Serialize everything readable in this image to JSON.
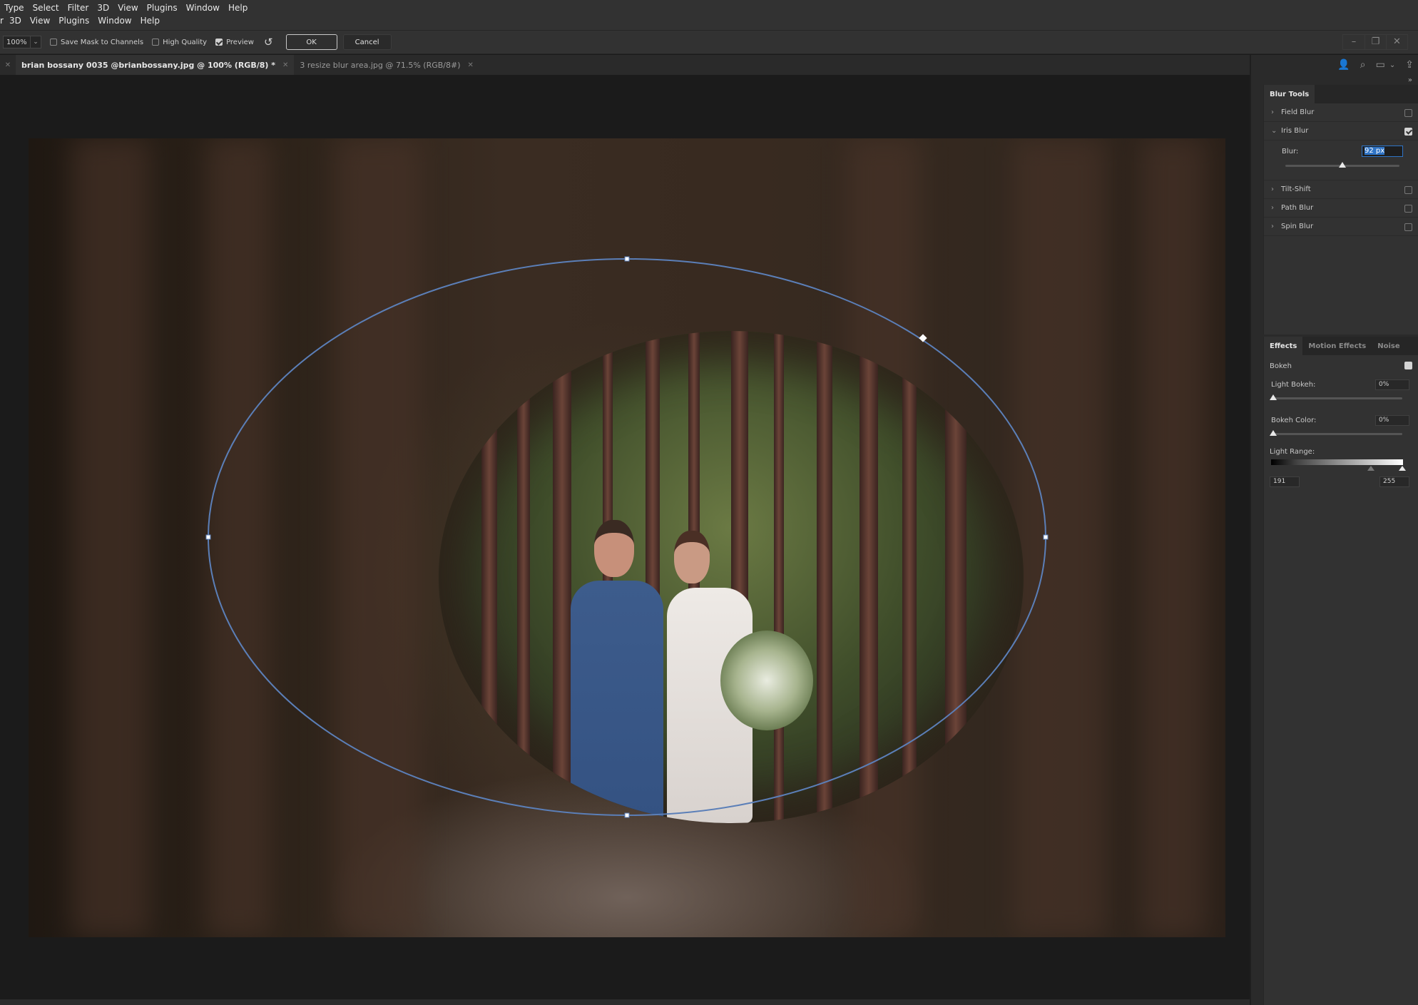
{
  "menubar_row1": [
    "Type",
    "Select",
    "Filter",
    "3D",
    "View",
    "Plugins",
    "Window",
    "Help"
  ],
  "menubar_row2": [
    "r",
    "3D",
    "View",
    "Plugins",
    "Window",
    "Help"
  ],
  "options": {
    "zoom_value": "100%",
    "save_mask_label": "Save Mask to Channels",
    "save_mask_checked": false,
    "high_quality_label": "High Quality",
    "high_quality_checked": false,
    "preview_label": "Preview",
    "preview_checked": true,
    "ok_label": "OK",
    "cancel_label": "Cancel"
  },
  "window_controls": {
    "minimize": "–",
    "restore": "❐",
    "close": "✕"
  },
  "tabs": [
    {
      "label": "brian bossany 0035 @brianbossany.jpg @ 100% (RGB/8) *",
      "active": true
    },
    {
      "label": "3 resize blur area.jpg @ 71.5% (RGB/8#)",
      "active": false
    }
  ],
  "dock_icons": [
    "learn-icon",
    "search-icon",
    "workspace-icon",
    "share-icon"
  ],
  "blur_tools": {
    "tab_label": "Blur Tools",
    "items": [
      {
        "label": "Field Blur",
        "expanded": false,
        "checked": false
      },
      {
        "label": "Iris Blur",
        "expanded": true,
        "checked": true
      },
      {
        "label": "Tilt-Shift",
        "expanded": false,
        "checked": false
      },
      {
        "label": "Path Blur",
        "expanded": false,
        "checked": false
      },
      {
        "label": "Spin Blur",
        "expanded": false,
        "checked": false
      }
    ],
    "iris": {
      "blur_label": "Blur:",
      "blur_value": "92 px",
      "blur_amount_fraction": 0.5
    }
  },
  "effects": {
    "tabs": [
      "Effects",
      "Motion Effects",
      "Noise"
    ],
    "active_tab": "Effects",
    "bokeh_label": "Bokeh",
    "bokeh_checked": true,
    "light_bokeh_label": "Light Bokeh:",
    "light_bokeh_value": "0%",
    "bokeh_color_label": "Bokeh Color:",
    "bokeh_color_value": "0%",
    "light_range_label": "Light Range:",
    "light_range_low": "191",
    "light_range_high": "255"
  },
  "colors": {
    "accent_blue": "#2f74c6",
    "ellipse_stroke": "#5b7fb8",
    "panel_bg": "#323232",
    "app_bg": "#1b1b1b"
  }
}
